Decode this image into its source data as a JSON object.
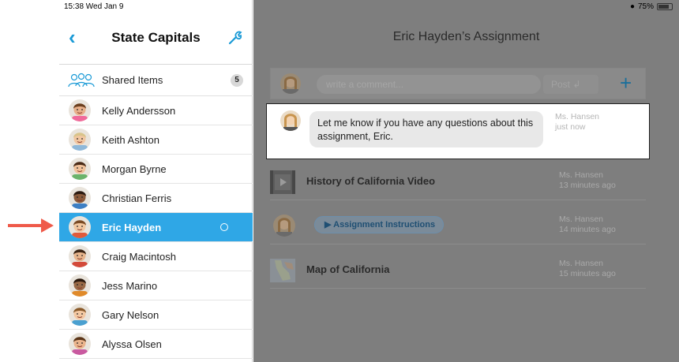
{
  "status_bar": {
    "time": "15:38  Wed Jan 9",
    "battery": "75%"
  },
  "sidebar": {
    "title": "State Capitals",
    "shared": {
      "label": "Shared Items",
      "count": "5"
    },
    "students": [
      {
        "name": "Kelly Andersson",
        "skin": "#e8b08a",
        "hair": "#6b3f1e",
        "shirt": "#f06a9a"
      },
      {
        "name": "Keith Ashton",
        "skin": "#f1c6a0",
        "hair": "#d9c48a",
        "shirt": "#8fb8d9"
      },
      {
        "name": "Morgan Byrne",
        "skin": "#f0c19a",
        "hair": "#4a2a16",
        "shirt": "#6bb36b"
      },
      {
        "name": "Christian Ferris",
        "skin": "#8a5a3a",
        "hair": "#2b1a10",
        "shirt": "#3d7fc4"
      },
      {
        "name": "Eric Hayden",
        "skin": "#f2c7a0",
        "hair": "#7a4a24",
        "shirt": "#e05a3a"
      },
      {
        "name": "Craig Macintosh",
        "skin": "#e7b58c",
        "hair": "#3b2413",
        "shirt": "#d34a3a"
      },
      {
        "name": "Jess Marino",
        "skin": "#9a6a46",
        "hair": "#2a180c",
        "shirt": "#e08a2a"
      },
      {
        "name": "Gary Nelson",
        "skin": "#f3c8a2",
        "hair": "#8a5a2a",
        "shirt": "#4aa0d0"
      },
      {
        "name": "Alyssa Olsen",
        "skin": "#eab48c",
        "hair": "#5a3417",
        "shirt": "#c95aa0"
      }
    ],
    "selected_index": 4
  },
  "main": {
    "title": "Eric Hayden’s Assignment",
    "comment_placeholder": "write a comment...",
    "post_label": "Post",
    "card": {
      "message": "Let me know if you have any questions about this assignment, Eric.",
      "author": "Ms. Hansen",
      "time": "just now"
    },
    "feed": [
      {
        "title": "History of California Video",
        "author": "Ms. Hansen",
        "time": "13 minutes ago",
        "kind": "video"
      },
      {
        "title": "Assignment Instructions",
        "author": "Ms. Hansen",
        "time": "14 minutes ago",
        "kind": "audio"
      },
      {
        "title": "Map of California",
        "author": "Ms. Hansen",
        "time": "15 minutes ago",
        "kind": "map"
      }
    ]
  },
  "colors": {
    "accent": "#2fa7e6",
    "arrow": "#ef5a4a",
    "dim_overlay": "#7e7e7e"
  }
}
